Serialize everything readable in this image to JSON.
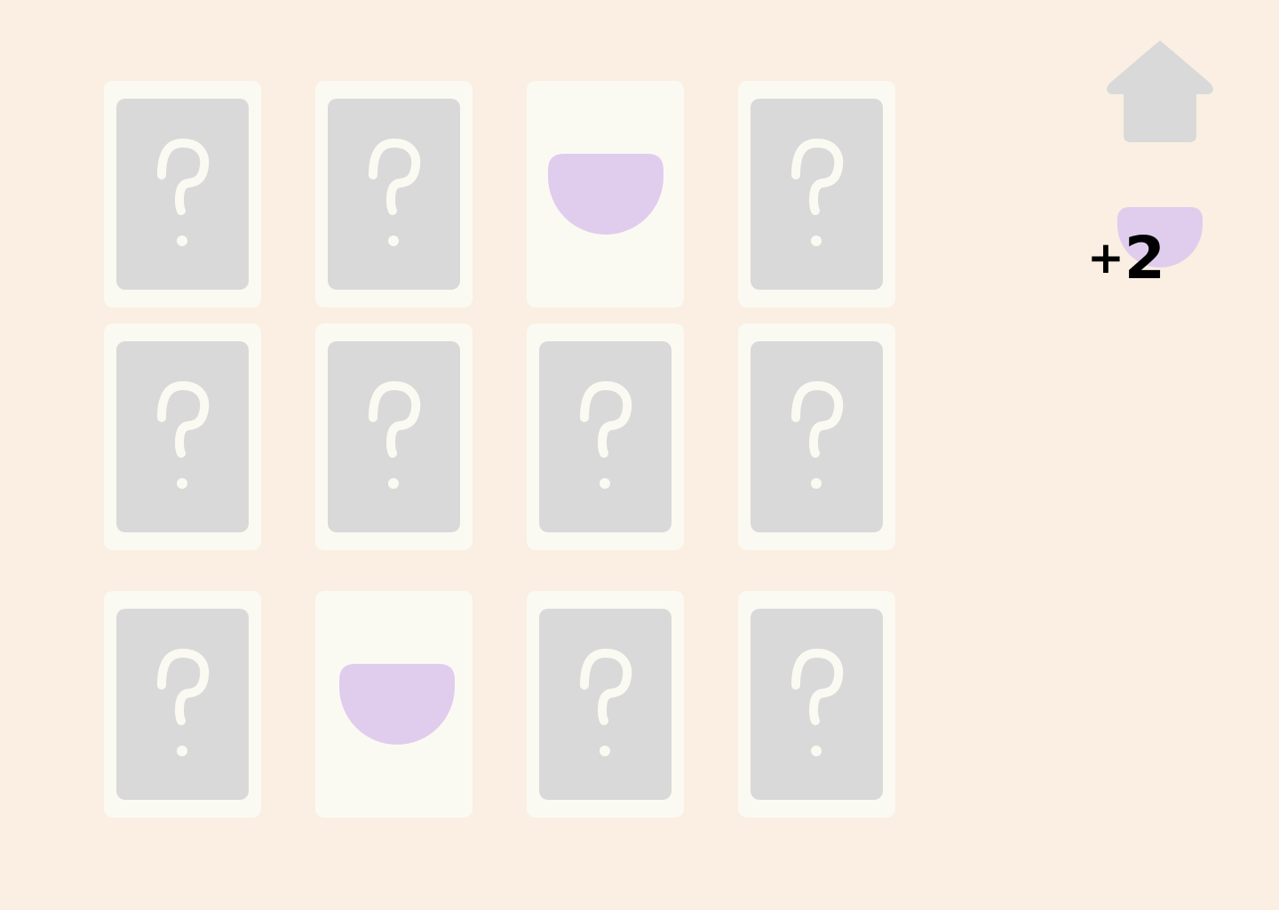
{
  "game": {
    "type": "memory-match",
    "columns": 4,
    "rows": 3,
    "cards": [
      {
        "id": "card-r1-c1",
        "state": "face-down",
        "symbol": "question-mark-icon"
      },
      {
        "id": "card-r1-c2",
        "state": "face-down",
        "symbol": "question-mark-icon"
      },
      {
        "id": "card-r1-c3",
        "state": "face-up",
        "symbol": "purple-bowl-icon"
      },
      {
        "id": "card-r1-c4",
        "state": "face-down",
        "symbol": "question-mark-icon"
      },
      {
        "id": "card-r2-c1",
        "state": "face-down",
        "symbol": "question-mark-icon"
      },
      {
        "id": "card-r2-c2",
        "state": "face-down",
        "symbol": "question-mark-icon"
      },
      {
        "id": "card-r2-c3",
        "state": "face-down",
        "symbol": "question-mark-icon"
      },
      {
        "id": "card-r2-c4",
        "state": "face-down",
        "symbol": "question-mark-icon"
      },
      {
        "id": "card-r3-c1",
        "state": "face-down",
        "symbol": "question-mark-icon"
      },
      {
        "id": "card-r3-c2",
        "state": "face-up",
        "symbol": "purple-bowl-icon"
      },
      {
        "id": "card-r3-c3",
        "state": "face-down",
        "symbol": "question-mark-icon"
      },
      {
        "id": "card-r3-c4",
        "state": "face-down",
        "symbol": "question-mark-icon"
      }
    ]
  },
  "home": {
    "icon": "home-icon"
  },
  "score": {
    "prefix": "+",
    "value": "2",
    "icon": "purple-bowl-icon"
  },
  "colors": {
    "background": "#faefe2",
    "card_frame": "#fbfaf2",
    "card_back": "#d9d9d9",
    "question_mark": "#fbfaf2",
    "bowl": "#e0cdee",
    "home_icon": "#d9d9d9",
    "score_text": "#000000"
  }
}
